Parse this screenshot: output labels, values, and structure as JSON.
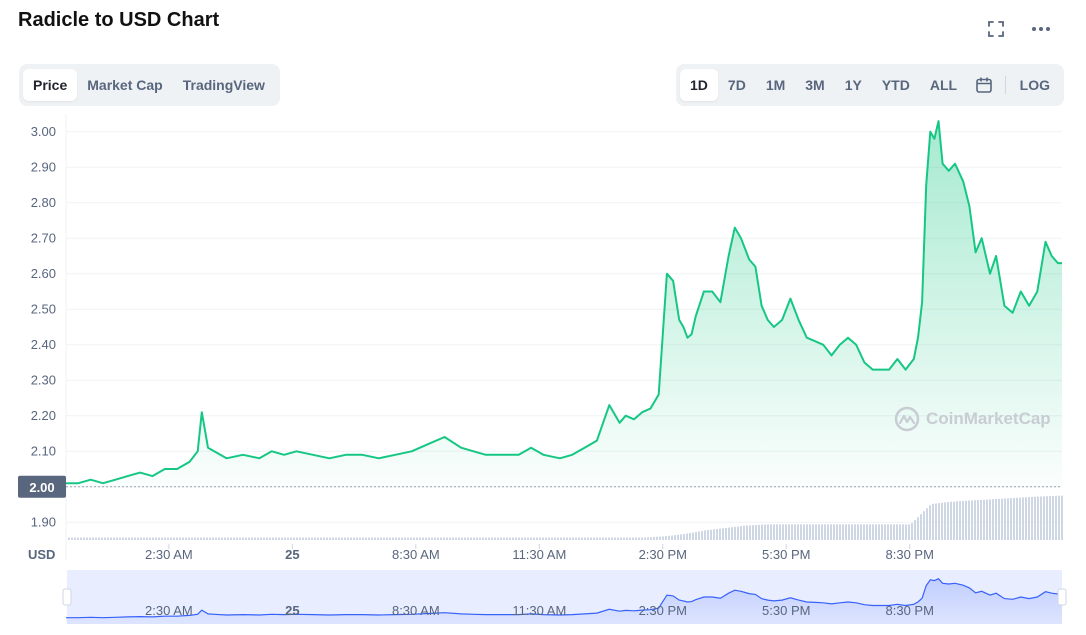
{
  "header": {
    "title": "Radicle to USD Chart"
  },
  "chart_tabs": [
    {
      "label": "Price",
      "active": true
    },
    {
      "label": "Market Cap",
      "active": false
    },
    {
      "label": "TradingView",
      "active": false
    }
  ],
  "range_buttons": [
    {
      "label": "1D",
      "active": true
    },
    {
      "label": "7D",
      "active": false
    },
    {
      "label": "1M",
      "active": false
    },
    {
      "label": "3M",
      "active": false
    },
    {
      "label": "1Y",
      "active": false
    },
    {
      "label": "YTD",
      "active": false
    },
    {
      "label": "ALL",
      "active": false
    }
  ],
  "log_label": "LOG",
  "icons": {
    "fullscreen": "fullscreen-icon",
    "more": "more-options-icon",
    "calendar": "calendar-icon"
  },
  "watermark": "CoinMarketCap",
  "colors": {
    "line": "#16c784",
    "navigator_line": "#3861fb",
    "volume": "#cfd6e4",
    "current_price_bg": "#58667e"
  },
  "chart_data": {
    "type": "area",
    "title": "Radicle to USD Chart",
    "ylabel": "USD",
    "ylim": [
      1.85,
      3.05
    ],
    "y_ticks": [
      "3.00",
      "2.90",
      "2.80",
      "2.70",
      "2.60",
      "2.50",
      "2.40",
      "2.30",
      "2.20",
      "2.10",
      "2.00",
      "1.90"
    ],
    "current_price_label": "2.00",
    "current_price": 2.0,
    "xlim": [
      0,
      24.2
    ],
    "x_ticks": [
      {
        "value": 2.5,
        "label": "2:30 AM",
        "bold": false
      },
      {
        "value": 5.5,
        "label": "25",
        "bold": true
      },
      {
        "value": 8.5,
        "label": "8:30 AM",
        "bold": false
      },
      {
        "value": 11.5,
        "label": "11:30 AM",
        "bold": false
      },
      {
        "value": 14.5,
        "label": "2:30 PM",
        "bold": false
      },
      {
        "value": 17.5,
        "label": "5:30 PM",
        "bold": false
      },
      {
        "value": 20.5,
        "label": "8:30 PM",
        "bold": false
      }
    ],
    "series": [
      {
        "x": [
          0,
          0.3,
          0.6,
          0.9,
          1.2,
          1.5,
          1.8,
          2.1,
          2.4,
          2.7,
          3.0,
          3.2,
          3.3,
          3.45,
          3.6,
          3.9,
          4.3,
          4.7,
          5.0,
          5.3,
          5.6,
          6.0,
          6.4,
          6.8,
          7.2,
          7.6,
          8.0,
          8.4,
          8.8,
          9.2,
          9.6,
          9.9,
          10.2,
          10.6,
          11.0,
          11.3,
          11.6,
          12.0,
          12.3,
          12.6,
          12.9,
          13.2,
          13.45,
          13.6,
          13.8,
          14.0,
          14.2,
          14.4,
          14.6,
          14.75,
          14.9,
          15.0,
          15.1,
          15.2,
          15.3,
          15.5,
          15.7,
          15.9,
          16.1,
          16.25,
          16.4,
          16.5,
          16.6,
          16.75,
          16.9,
          17.05,
          17.2,
          17.4,
          17.6,
          17.8,
          18.0,
          18.2,
          18.4,
          18.6,
          18.8,
          19.0,
          19.2,
          19.4,
          19.6,
          19.8,
          20.0,
          20.2,
          20.4,
          20.6,
          20.7,
          20.8,
          20.9,
          21.0,
          21.1,
          21.2,
          21.3,
          21.45,
          21.6,
          21.8,
          21.95,
          22.1,
          22.25,
          22.45,
          22.6,
          22.8,
          23.0,
          23.2,
          23.4,
          23.6,
          23.8,
          23.95,
          24.1,
          24.2
        ],
        "values": [
          2.01,
          2.01,
          2.02,
          2.01,
          2.02,
          2.03,
          2.04,
          2.03,
          2.05,
          2.05,
          2.07,
          2.1,
          2.21,
          2.11,
          2.1,
          2.08,
          2.09,
          2.08,
          2.1,
          2.09,
          2.1,
          2.09,
          2.08,
          2.09,
          2.09,
          2.08,
          2.09,
          2.1,
          2.12,
          2.14,
          2.11,
          2.1,
          2.09,
          2.09,
          2.09,
          2.11,
          2.09,
          2.08,
          2.09,
          2.11,
          2.13,
          2.23,
          2.18,
          2.2,
          2.19,
          2.21,
          2.22,
          2.26,
          2.6,
          2.58,
          2.47,
          2.45,
          2.42,
          2.43,
          2.48,
          2.55,
          2.55,
          2.52,
          2.65,
          2.73,
          2.7,
          2.67,
          2.64,
          2.62,
          2.51,
          2.47,
          2.45,
          2.47,
          2.53,
          2.47,
          2.42,
          2.41,
          2.4,
          2.37,
          2.4,
          2.42,
          2.4,
          2.35,
          2.33,
          2.33,
          2.33,
          2.36,
          2.33,
          2.36,
          2.42,
          2.52,
          2.85,
          3.0,
          2.98,
          3.03,
          2.91,
          2.89,
          2.91,
          2.86,
          2.79,
          2.66,
          2.7,
          2.6,
          2.65,
          2.51,
          2.49,
          2.55,
          2.51,
          2.55,
          2.69,
          2.65,
          2.63,
          2.63
        ]
      }
    ],
    "volume": {
      "x": [
        0,
        1,
        2,
        3,
        4,
        5,
        6,
        7,
        8,
        9,
        10,
        11,
        12,
        13,
        13.5,
        14,
        14.5,
        15,
        15.5,
        16,
        16.5,
        17,
        17.5,
        18,
        18.5,
        19,
        19.5,
        20,
        20.5,
        21,
        21.5,
        22,
        22.5,
        23,
        23.5,
        24.2
      ],
      "values": [
        2,
        2,
        2,
        2,
        2,
        2,
        2,
        2,
        2,
        2,
        2,
        2,
        2,
        2,
        2,
        2,
        3,
        5,
        8,
        10,
        12,
        13,
        13,
        13,
        13,
        13,
        13,
        13,
        13,
        30,
        32,
        33,
        34,
        35,
        36,
        37
      ]
    }
  }
}
